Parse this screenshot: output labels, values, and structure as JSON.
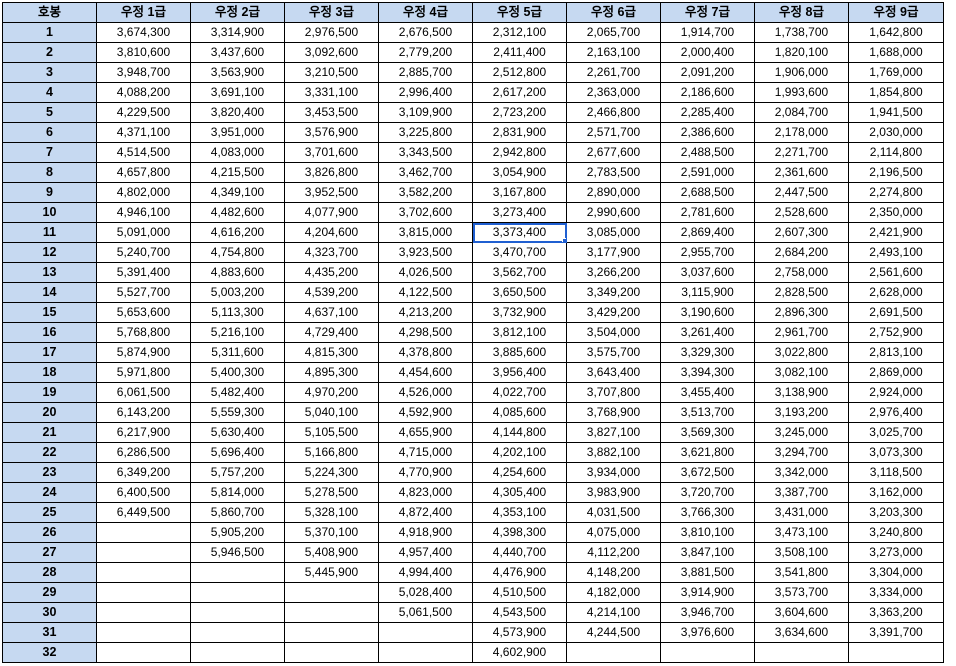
{
  "header": {
    "row_label": "호봉",
    "grades": [
      "우정 1급",
      "우정 2급",
      "우정 3급",
      "우정 4급",
      "우정 5급",
      "우정 6급",
      "우정 7급",
      "우정 8급",
      "우정 9급"
    ]
  },
  "rows": [
    {
      "step": "1",
      "values": [
        "3,674,300",
        "3,314,900",
        "2,976,500",
        "2,676,500",
        "2,312,100",
        "2,065,700",
        "1,914,700",
        "1,738,700",
        "1,642,800"
      ]
    },
    {
      "step": "2",
      "values": [
        "3,810,600",
        "3,437,600",
        "3,092,600",
        "2,779,200",
        "2,411,400",
        "2,163,100",
        "2,000,400",
        "1,820,100",
        "1,688,000"
      ]
    },
    {
      "step": "3",
      "values": [
        "3,948,700",
        "3,563,900",
        "3,210,500",
        "2,885,700",
        "2,512,800",
        "2,261,700",
        "2,091,200",
        "1,906,000",
        "1,769,000"
      ]
    },
    {
      "step": "4",
      "values": [
        "4,088,200",
        "3,691,100",
        "3,331,100",
        "2,996,400",
        "2,617,200",
        "2,363,000",
        "2,186,600",
        "1,993,600",
        "1,854,800"
      ]
    },
    {
      "step": "5",
      "values": [
        "4,229,500",
        "3,820,400",
        "3,453,500",
        "3,109,900",
        "2,723,200",
        "2,466,800",
        "2,285,400",
        "2,084,700",
        "1,941,500"
      ]
    },
    {
      "step": "6",
      "values": [
        "4,371,100",
        "3,951,000",
        "3,576,900",
        "3,225,800",
        "2,831,900",
        "2,571,700",
        "2,386,600",
        "2,178,000",
        "2,030,000"
      ]
    },
    {
      "step": "7",
      "values": [
        "4,514,500",
        "4,083,000",
        "3,701,600",
        "3,343,500",
        "2,942,800",
        "2,677,600",
        "2,488,500",
        "2,271,700",
        "2,114,800"
      ]
    },
    {
      "step": "8",
      "values": [
        "4,657,800",
        "4,215,500",
        "3,826,800",
        "3,462,700",
        "3,054,900",
        "2,783,500",
        "2,591,000",
        "2,361,600",
        "2,196,500"
      ]
    },
    {
      "step": "9",
      "values": [
        "4,802,000",
        "4,349,100",
        "3,952,500",
        "3,582,200",
        "3,167,800",
        "2,890,000",
        "2,688,500",
        "2,447,500",
        "2,274,800"
      ]
    },
    {
      "step": "10",
      "values": [
        "4,946,100",
        "4,482,600",
        "4,077,900",
        "3,702,600",
        "3,273,400",
        "2,990,600",
        "2,781,600",
        "2,528,600",
        "2,350,000"
      ]
    },
    {
      "step": "11",
      "values": [
        "5,091,000",
        "4,616,200",
        "4,204,600",
        "3,815,000",
        "3,373,400",
        "3,085,000",
        "2,869,400",
        "2,607,300",
        "2,421,900"
      ]
    },
    {
      "step": "12",
      "values": [
        "5,240,700",
        "4,754,800",
        "4,323,700",
        "3,923,500",
        "3,470,700",
        "3,177,900",
        "2,955,700",
        "2,684,200",
        "2,493,100"
      ]
    },
    {
      "step": "13",
      "values": [
        "5,391,400",
        "4,883,600",
        "4,435,200",
        "4,026,500",
        "3,562,700",
        "3,266,200",
        "3,037,600",
        "2,758,000",
        "2,561,600"
      ]
    },
    {
      "step": "14",
      "values": [
        "5,527,700",
        "5,003,200",
        "4,539,200",
        "4,122,500",
        "3,650,500",
        "3,349,200",
        "3,115,900",
        "2,828,500",
        "2,628,000"
      ]
    },
    {
      "step": "15",
      "values": [
        "5,653,600",
        "5,113,300",
        "4,637,100",
        "4,213,200",
        "3,732,900",
        "3,429,200",
        "3,190,600",
        "2,896,300",
        "2,691,500"
      ]
    },
    {
      "step": "16",
      "values": [
        "5,768,800",
        "5,216,100",
        "4,729,400",
        "4,298,500",
        "3,812,100",
        "3,504,000",
        "3,261,400",
        "2,961,700",
        "2,752,900"
      ]
    },
    {
      "step": "17",
      "values": [
        "5,874,900",
        "5,311,600",
        "4,815,300",
        "4,378,800",
        "3,885,600",
        "3,575,700",
        "3,329,300",
        "3,022,800",
        "2,813,100"
      ]
    },
    {
      "step": "18",
      "values": [
        "5,971,800",
        "5,400,300",
        "4,895,300",
        "4,454,600",
        "3,956,400",
        "3,643,400",
        "3,394,300",
        "3,082,100",
        "2,869,000"
      ]
    },
    {
      "step": "19",
      "values": [
        "6,061,500",
        "5,482,400",
        "4,970,200",
        "4,526,000",
        "4,022,700",
        "3,707,800",
        "3,455,400",
        "3,138,900",
        "2,924,000"
      ]
    },
    {
      "step": "20",
      "values": [
        "6,143,200",
        "5,559,300",
        "5,040,100",
        "4,592,900",
        "4,085,600",
        "3,768,900",
        "3,513,700",
        "3,193,200",
        "2,976,400"
      ]
    },
    {
      "step": "21",
      "values": [
        "6,217,900",
        "5,630,400",
        "5,105,500",
        "4,655,900",
        "4,144,800",
        "3,827,100",
        "3,569,300",
        "3,245,000",
        "3,025,700"
      ]
    },
    {
      "step": "22",
      "values": [
        "6,286,500",
        "5,696,400",
        "5,166,800",
        "4,715,000",
        "4,202,100",
        "3,882,100",
        "3,621,800",
        "3,294,700",
        "3,073,300"
      ]
    },
    {
      "step": "23",
      "values": [
        "6,349,200",
        "5,757,200",
        "5,224,300",
        "4,770,900",
        "4,254,600",
        "3,934,000",
        "3,672,500",
        "3,342,000",
        "3,118,500"
      ]
    },
    {
      "step": "24",
      "values": [
        "6,400,500",
        "5,814,000",
        "5,278,500",
        "4,823,000",
        "4,305,400",
        "3,983,900",
        "3,720,700",
        "3,387,700",
        "3,162,000"
      ]
    },
    {
      "step": "25",
      "values": [
        "6,449,500",
        "5,860,700",
        "5,328,100",
        "4,872,400",
        "4,353,100",
        "4,031,500",
        "3,766,300",
        "3,431,000",
        "3,203,300"
      ]
    },
    {
      "step": "26",
      "values": [
        "",
        "5,905,200",
        "5,370,100",
        "4,918,900",
        "4,398,300",
        "4,075,000",
        "3,810,100",
        "3,473,100",
        "3,240,800"
      ]
    },
    {
      "step": "27",
      "values": [
        "",
        "5,946,500",
        "5,408,900",
        "4,957,400",
        "4,440,700",
        "4,112,200",
        "3,847,100",
        "3,508,100",
        "3,273,000"
      ]
    },
    {
      "step": "28",
      "values": [
        "",
        "",
        "5,445,900",
        "4,994,400",
        "4,476,900",
        "4,148,200",
        "3,881,500",
        "3,541,800",
        "3,304,000"
      ]
    },
    {
      "step": "29",
      "values": [
        "",
        "",
        "",
        "5,028,400",
        "4,510,500",
        "4,182,000",
        "3,914,900",
        "3,573,700",
        "3,334,000"
      ]
    },
    {
      "step": "30",
      "values": [
        "",
        "",
        "",
        "5,061,500",
        "4,543,500",
        "4,214,100",
        "3,946,700",
        "3,604,600",
        "3,363,200"
      ]
    },
    {
      "step": "31",
      "values": [
        "",
        "",
        "",
        "",
        "4,573,900",
        "4,244,500",
        "3,976,600",
        "3,634,600",
        "3,391,700"
      ]
    },
    {
      "step": "32",
      "values": [
        "",
        "",
        "",
        "",
        "4,602,900",
        "",
        "",
        "",
        ""
      ]
    }
  ],
  "selection": {
    "row": 10,
    "col": 4
  },
  "colors": {
    "header_bg": "#c6d9f1",
    "selection": "#1f5fd1",
    "grid": "#000000"
  }
}
